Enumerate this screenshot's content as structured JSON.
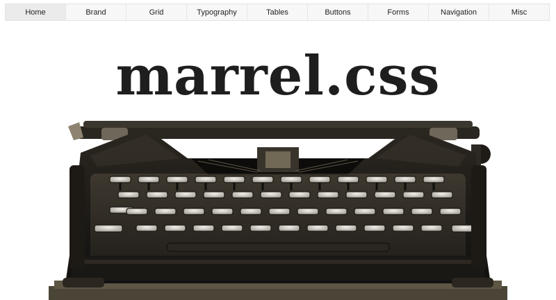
{
  "nav": {
    "items": [
      {
        "label": "Home",
        "active": true
      },
      {
        "label": "Brand",
        "active": false
      },
      {
        "label": "Grid",
        "active": false
      },
      {
        "label": "Typography",
        "active": false
      },
      {
        "label": "Tables",
        "active": false
      },
      {
        "label": "Buttons",
        "active": false
      },
      {
        "label": "Forms",
        "active": false
      },
      {
        "label": "Navigation",
        "active": false
      },
      {
        "label": "Misc",
        "active": false
      }
    ]
  },
  "hero": {
    "title": "marrel.css",
    "image_icon": "typewriter-image"
  },
  "colors": {
    "nav_background": "#f7f7f7",
    "nav_active": "#ebebeb",
    "title": "#1e1e1e",
    "typewriter_body": "#1c1a15"
  }
}
